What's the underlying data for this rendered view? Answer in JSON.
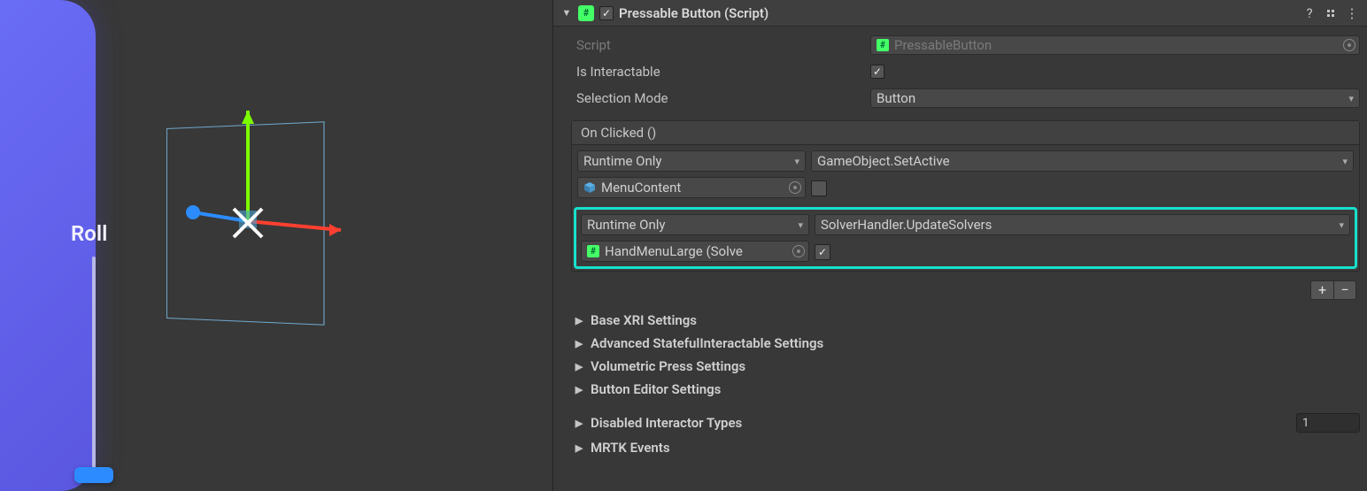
{
  "scene": {
    "panel_label": "Roll"
  },
  "inspector": {
    "component_title": "Pressable Button (Script)",
    "enabled": true,
    "script_field": {
      "label": "Script",
      "value": "PressableButton"
    },
    "is_interactable": {
      "label": "Is Interactable",
      "value": true
    },
    "selection_mode": {
      "label": "Selection Mode",
      "value": "Button"
    },
    "event": {
      "title": "On Clicked ()",
      "entries": [
        {
          "callstate": "Runtime Only",
          "target": "MenuContent",
          "target_icon": "cube",
          "function": "GameObject.SetActive",
          "arg_type": "bool",
          "arg_bool": false,
          "highlighted": false
        },
        {
          "callstate": "Runtime Only",
          "target": "HandMenuLarge (Solve",
          "target_icon": "script",
          "function": "SolverHandler.UpdateSolvers",
          "arg_type": "bool",
          "arg_bool": true,
          "highlighted": true
        }
      ]
    },
    "sections": [
      {
        "label": "Base XRI Settings"
      },
      {
        "label": "Advanced StatefulInteractable Settings"
      },
      {
        "label": "Volumetric Press Settings"
      },
      {
        "label": "Button Editor Settings"
      }
    ],
    "disabled_interactor_types": {
      "label": "Disabled Interactor Types",
      "count": "1"
    },
    "mrtk_events": {
      "label": "MRTK Events"
    }
  }
}
